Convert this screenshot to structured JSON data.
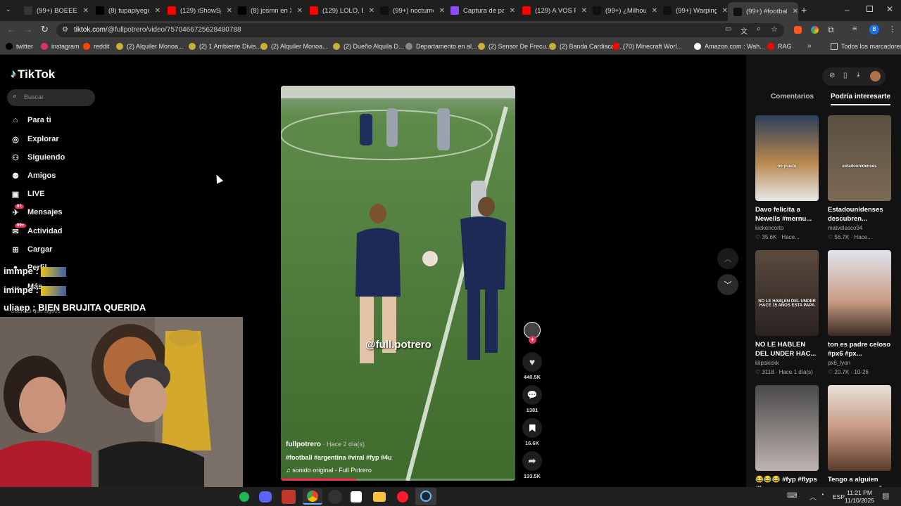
{
  "browser": {
    "tabs": [
      {
        "label": "(99+) BOEEE #",
        "icon_color": "#333"
      },
      {
        "label": "(8) tupapiyego",
        "icon_color": "#000"
      },
      {
        "label": "(129) iShowSp",
        "icon_color": "#ff0000"
      },
      {
        "label": "(8) josmn en X",
        "icon_color": "#000"
      },
      {
        "label": "(129) LOLO, BA",
        "icon_color": "#ff0000"
      },
      {
        "label": "(99+) nocturno",
        "icon_color": "#111"
      },
      {
        "label": "Captura de pa",
        "icon_color": "#8a4cff"
      },
      {
        "label": "(129) A VOS PA",
        "icon_color": "#ff0000"
      },
      {
        "label": "(99+) ¿Milhous",
        "icon_color": "#111"
      },
      {
        "label": "(99+) Warping",
        "icon_color": "#111"
      },
      {
        "label": "(99+) #football",
        "icon_color": "#111"
      }
    ],
    "url_host": "tiktok.com",
    "url_path": "/@fullpotrero/video/7570466725628480788",
    "bookmarks": [
      {
        "label": "twitter",
        "color": "#000"
      },
      {
        "label": "instagram",
        "color": "#e1306c"
      },
      {
        "label": "reddit",
        "color": "#ff4500"
      },
      {
        "label": "(2) Alquiler Monoa...",
        "color": "#c9b037"
      },
      {
        "label": "(2) 1 Ambiente Divis...",
        "color": "#c9b037"
      },
      {
        "label": "(2) Alquiler Monoa...",
        "color": "#c9b037"
      },
      {
        "label": "(2) Dueño Alquila D...",
        "color": "#c9b037"
      },
      {
        "label": "Departamento en al...",
        "color": "#888"
      },
      {
        "label": "(2) Sensor De Frecu...",
        "color": "#c9b037"
      },
      {
        "label": "(2) Banda Cardiaca J...",
        "color": "#c9b037"
      },
      {
        "label": "(70) Minecraft Worl...",
        "color": "#ff0000"
      },
      {
        "label": "Amazon.com : Wah...",
        "color": "#fff"
      },
      {
        "label": "RAG",
        "color": "#ff0000"
      }
    ],
    "all_bookmarks": "Todos los marcadores"
  },
  "tiktok": {
    "logo": "TikTok",
    "search_placeholder": "Buscar",
    "nav": [
      {
        "label": "Para ti",
        "icon": "home-icon"
      },
      {
        "label": "Explorar",
        "icon": "compass-icon"
      },
      {
        "label": "Siguiendo",
        "icon": "following-icon"
      },
      {
        "label": "Amigos",
        "icon": "friends-icon"
      },
      {
        "label": "LIVE",
        "icon": "live-icon"
      },
      {
        "label": "Mensajes",
        "icon": "messages-icon",
        "badge": "97"
      },
      {
        "label": "Actividad",
        "icon": "activity-icon",
        "badge": "99+"
      },
      {
        "label": "Cargar",
        "icon": "upload-icon"
      },
      {
        "label": "Perfil",
        "icon": "profile-icon"
      },
      {
        "label": "Más",
        "icon": "more-icon"
      }
    ],
    "following_accounts_label": "Cuentas que sigues",
    "video": {
      "overlay_text": "@full.potrero",
      "author": "fullpotrero",
      "time": "· Hace 2 día(s)",
      "hashtags": "#football #argentina #viral #fyp #4u",
      "sound": "sonido original - Full Potrero",
      "progress": 0.32
    },
    "actions": {
      "likes": "440.5K",
      "comments": "1381",
      "saves": "16.6K",
      "shares": "133.5K"
    },
    "right_panel": {
      "tabs": [
        "Comentarios",
        "Podría interesarte"
      ],
      "cards": [
        {
          "title": "Davo felicita a Newells #mernu...",
          "author": "kickencorto",
          "stats": "♡ 35.6K · Hace...",
          "thumb_text": "no puedo"
        },
        {
          "title": "Estadounidenses descubren...",
          "author": "matvelasco94",
          "stats": "♡ 56.7K · Hace...",
          "thumb_text": "estadounidenses"
        },
        {
          "title": "NO LE HABLEN DEL UNDER HAC...",
          "author": "klipskickk",
          "stats": "♡ 3118 · Hace 1 día(s)",
          "thumb_text": "NO LE HABLEN DEL UNDER HACE 15 AÑOS ESTA PAPA"
        },
        {
          "title": "ton es padre celoso #px6 #px...",
          "author": "px6_lyon",
          "stats": "♡ 20.7K · 10-26",
          "thumb_text": ""
        },
        {
          "title": "😂😂😂 #fyp #flyps #foryou",
          "author": "",
          "stats": "",
          "thumb_text": ""
        },
        {
          "title": "Tengo a alguien que me acompañ...",
          "author": "",
          "stats": "",
          "thumb_text": ""
        }
      ]
    }
  },
  "stream_overlay": {
    "chat_lines": [
      "immpe :",
      "immpe :",
      "uliaep : BIEN BRUJITA QUERIDA"
    ]
  },
  "taskbar": {
    "lang": "ESP",
    "time": "11:21 PM",
    "date": "11/10/2025"
  }
}
